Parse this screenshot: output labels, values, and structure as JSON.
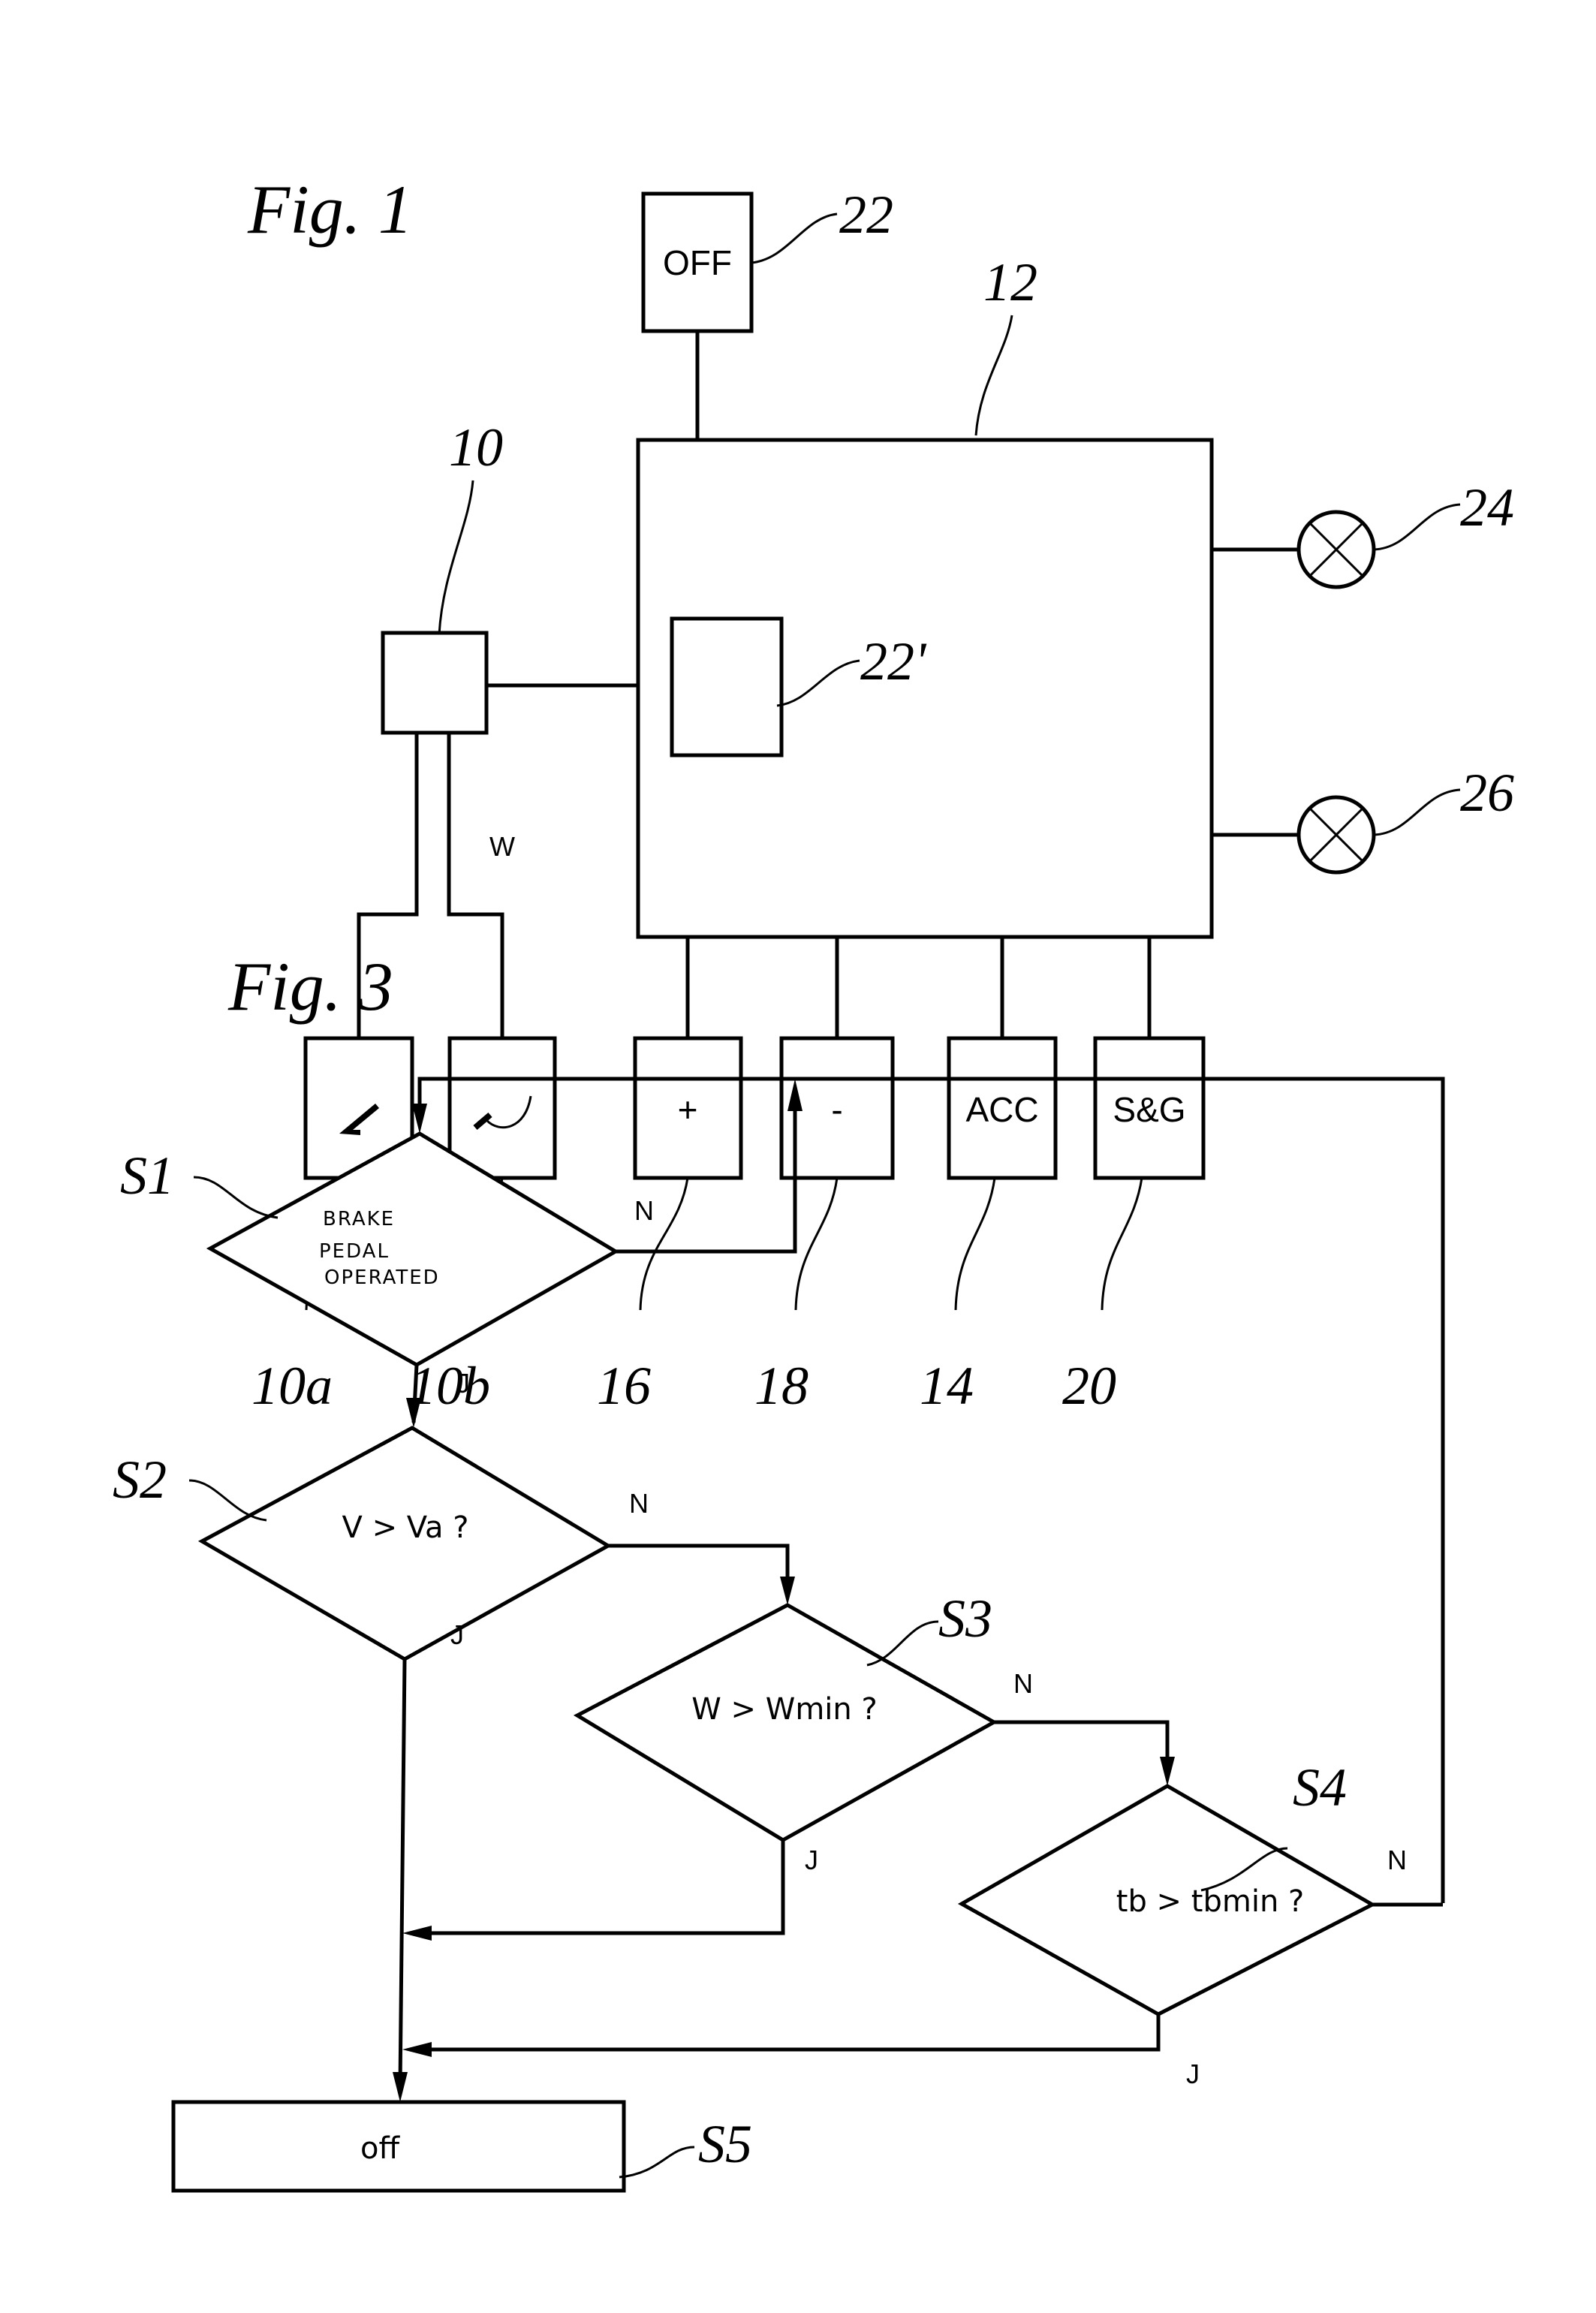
{
  "figure1": {
    "title": "Fig. 1",
    "refs": {
      "sensor": "10",
      "controller": "12",
      "off_button": "22",
      "off_internal": "22'",
      "lamp_top": "24",
      "lamp_bottom": "26",
      "pedal_accel": "10a",
      "pedal_brake": "10b",
      "plus": "16",
      "minus": "18",
      "acc": "14",
      "sg": "20"
    },
    "off_label": "OFF",
    "signal_label": "W",
    "bottom_boxes": [
      {
        "label": "",
        "icon": "accelerator-pedal-icon",
        "ref": "10a"
      },
      {
        "label": "",
        "icon": "brake-pedal-icon",
        "ref": "10b"
      },
      {
        "label": "+",
        "ref": "16"
      },
      {
        "label": "-",
        "ref": "18"
      },
      {
        "label": "ACC",
        "ref": "14"
      },
      {
        "label": "S&G",
        "ref": "20"
      }
    ]
  },
  "figure3": {
    "title": "Fig. 3",
    "steps": {
      "s1": {
        "ref": "S1",
        "text_lines": [
          "BRAKE",
          "PEDAL",
          "OPERATED"
        ],
        "yes": "J",
        "no": "N"
      },
      "s2": {
        "ref": "S2",
        "text": "V > Va ?",
        "yes": "J",
        "no": "N"
      },
      "s3": {
        "ref": "S3",
        "text": "W > Wmin ?",
        "yes": "J",
        "no": "N"
      },
      "s4": {
        "ref": "S4",
        "text": "tb > tbmin ?",
        "yes": "J",
        "no": "N"
      },
      "s5": {
        "ref": "S5",
        "text": "off"
      }
    }
  }
}
